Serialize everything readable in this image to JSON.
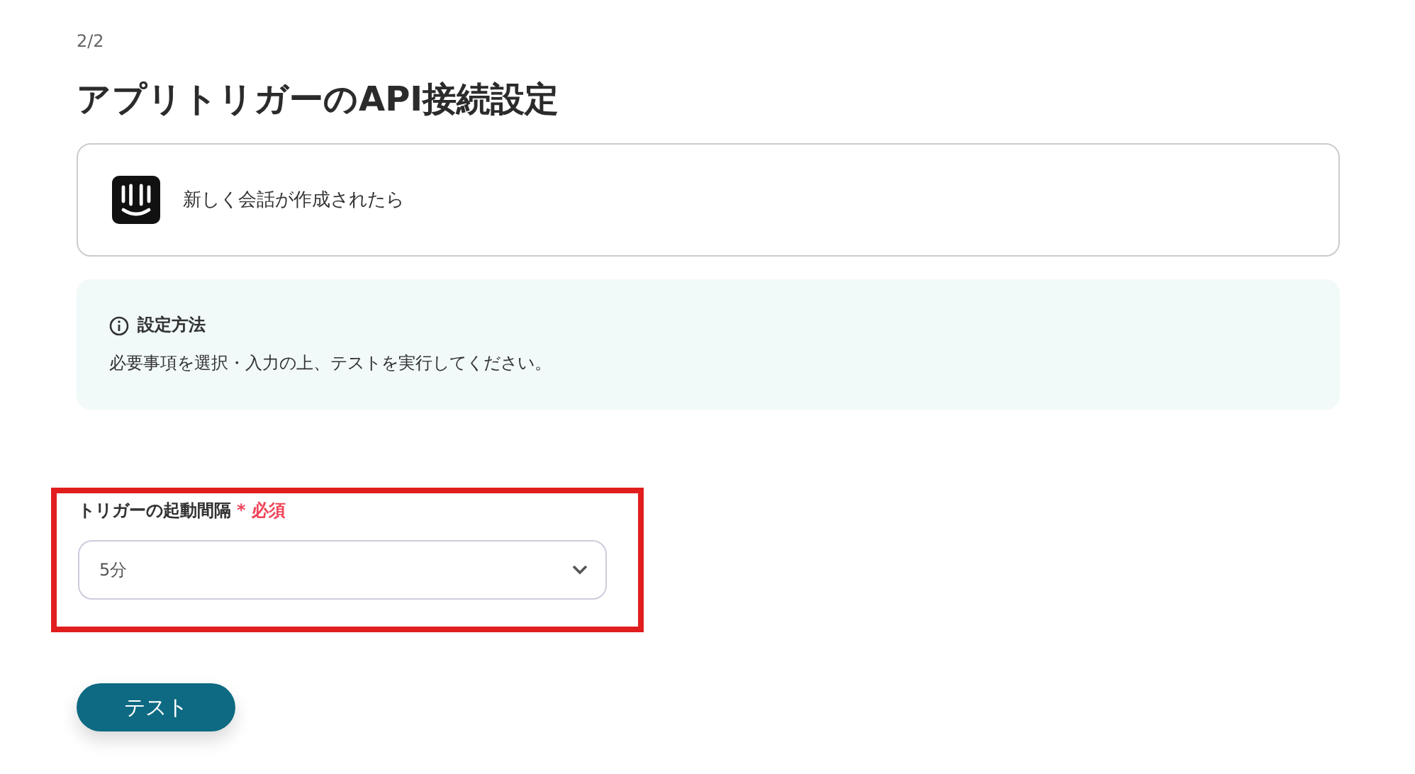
{
  "step": "2/2",
  "title": "アプリトリガーのAPI接続設定",
  "trigger": {
    "label": "新しく会話が作成されたら"
  },
  "info": {
    "heading": "設定方法",
    "text": "必要事項を選択・入力の上、テストを実行してください。"
  },
  "field": {
    "label": "トリガーの起動間隔",
    "required_mark": "*",
    "required_label": "必須",
    "value": "5分",
    "highlighted": true
  },
  "buttons": [
    "テスト"
  ]
}
